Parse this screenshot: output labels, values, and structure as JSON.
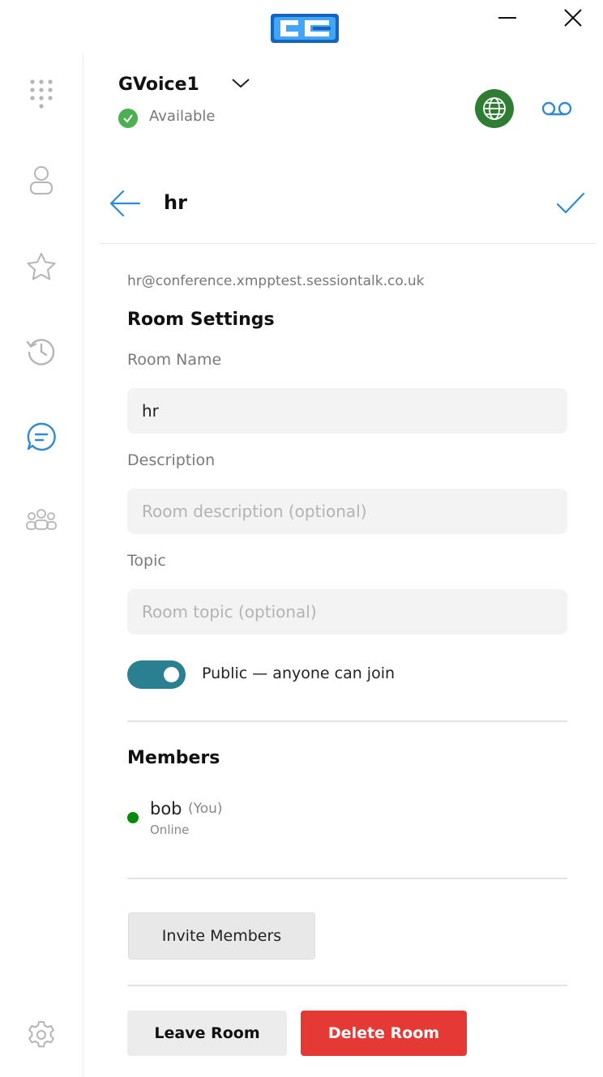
{
  "window": {
    "logo": "cc-logo-icon",
    "minimize": "minimize-icon",
    "close": "close-icon"
  },
  "rail": {
    "items": [
      "dialpad-icon",
      "contacts-icon",
      "favorites-icon",
      "history-icon",
      "chat-icon",
      "groups-icon",
      "settings-icon"
    ],
    "active": "chat-icon",
    "active_color": "#2f8ad3"
  },
  "header": {
    "account_name": "GVoice1",
    "status": "Available",
    "status_color": "#4caf50",
    "globe_color": "#2e7d32"
  },
  "room": {
    "title": "hr",
    "jid": "hr@conference.xmpptest.sessiontalk.co.uk"
  },
  "settings": {
    "section_title": "Room Settings",
    "room_name_label": "Room Name",
    "room_name_value": "hr",
    "description_label": "Description",
    "description_placeholder": "Room description (optional)",
    "topic_label": "Topic",
    "topic_placeholder": "Room topic (optional)",
    "public_label": "Public — anyone can join",
    "public_on": true,
    "toggle_color": "#2a7f91"
  },
  "members": {
    "section_title": "Members",
    "list": [
      {
        "name": "bob",
        "tag": "(You)",
        "status": "Online",
        "status_color": "#0a8a0a"
      }
    ]
  },
  "actions": {
    "invite_label": "Invite Members",
    "leave_label": "Leave Room",
    "delete_label": "Delete Room",
    "delete_color": "#e53935"
  }
}
